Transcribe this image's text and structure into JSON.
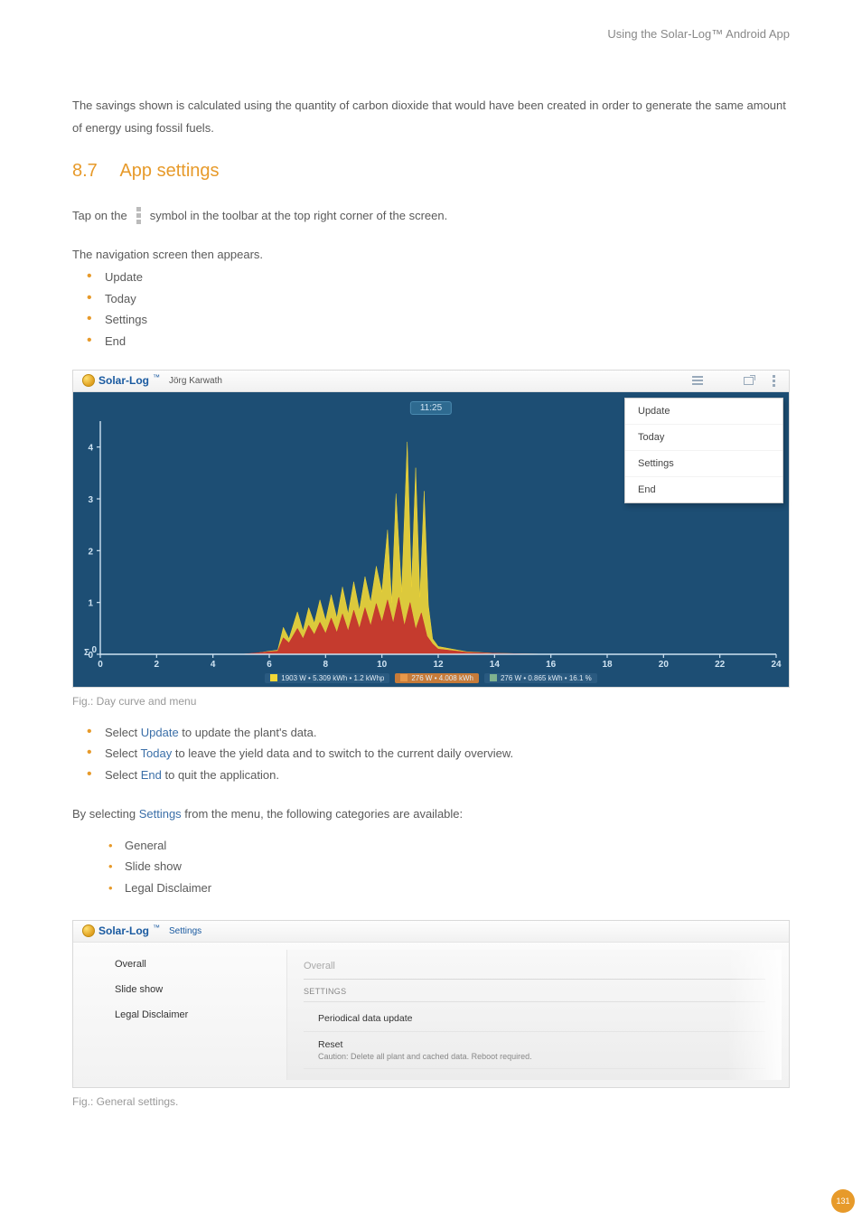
{
  "header": {
    "title": "Using the Solar-Log™ Android App"
  },
  "intro": "The savings shown is calculated using the quantity of carbon dioxide that would have been created in order to generate the same amount of energy using fossil fuels.",
  "section": {
    "num": "8.7",
    "title": "App settings"
  },
  "tap_line": {
    "pre": "Tap on the",
    "post": "symbol in the toolbar at the top right corner of the screen."
  },
  "nav_intro": "The navigation screen then appears.",
  "nav_items": {
    "a": "Update",
    "b": "Today",
    "c": "Settings",
    "d": "End"
  },
  "shot1": {
    "brand": "Solar-Log",
    "plant_name": "Jörg Karwath",
    "clock": "11:25",
    "menu": {
      "a": "Update",
      "b": "Today",
      "c": "Settings",
      "d": "End"
    },
    "legend": {
      "a": "1903 W • 5.309 kWh • 1.2 kWhp",
      "b": "276 W • 4.008 kWh",
      "c": "276 W • 0.865 kWh • 16.1 %"
    }
  },
  "fig1_cap": "Fig.: Day curve and menu",
  "instructions": {
    "a_pre": "Select ",
    "a_kw": "Update",
    "a_post": " to update the plant's data.",
    "b_pre": "Select ",
    "b_kw": "Today",
    "b_post": " to leave the yield data and to switch to the current daily overview.",
    "c_pre": "Select ",
    "c_kw": "End",
    "c_post": " to quit the application."
  },
  "settings_para_pre": "By selecting ",
  "settings_kw": "Settings",
  "settings_para_post": " from the menu, the following categories are available:",
  "settings_cats": {
    "a": "General",
    "b": "Slide show",
    "c": "Legal Disclaimer"
  },
  "shot2": {
    "brand": "Solar-Log",
    "crumb": "Settings",
    "side": {
      "a": "Overall",
      "b": "Slide show",
      "c": "Legal Disclaimer"
    },
    "main": {
      "heading": "Overall",
      "sub": "SETTINGS",
      "item1": "Periodical data update",
      "item2": "Reset",
      "item2_cap": "Caution: Delete all plant and cached data. Reboot required."
    }
  },
  "fig2_cap": "Fig.: General settings.",
  "page_num": "131",
  "chart_data": {
    "type": "area",
    "xlabel": "",
    "ylabel": "",
    "x_ticks": [
      0,
      2,
      4,
      6,
      8,
      10,
      12,
      14,
      16,
      18,
      20,
      22,
      24
    ],
    "y_ticks": [
      0,
      1,
      2,
      3,
      4
    ],
    "xlim": [
      0,
      24
    ],
    "ylim": [
      0,
      4.5
    ],
    "units": "kW",
    "series": [
      {
        "name": "yellow",
        "color": "#f2d736",
        "points": [
          [
            5.0,
            0.0
          ],
          [
            5.5,
            0.02
          ],
          [
            6.0,
            0.06
          ],
          [
            6.3,
            0.08
          ],
          [
            6.5,
            0.52
          ],
          [
            6.7,
            0.3
          ],
          [
            7.0,
            0.82
          ],
          [
            7.2,
            0.45
          ],
          [
            7.4,
            0.9
          ],
          [
            7.6,
            0.6
          ],
          [
            7.8,
            1.05
          ],
          [
            8.0,
            0.65
          ],
          [
            8.2,
            1.15
          ],
          [
            8.4,
            0.7
          ],
          [
            8.6,
            1.3
          ],
          [
            8.8,
            0.78
          ],
          [
            9.0,
            1.4
          ],
          [
            9.2,
            0.85
          ],
          [
            9.4,
            1.5
          ],
          [
            9.6,
            1.0
          ],
          [
            9.8,
            1.7
          ],
          [
            10.0,
            1.2
          ],
          [
            10.2,
            2.4
          ],
          [
            10.35,
            1.0
          ],
          [
            10.5,
            3.1
          ],
          [
            10.7,
            1.2
          ],
          [
            10.9,
            4.1
          ],
          [
            11.05,
            1.3
          ],
          [
            11.2,
            3.6
          ],
          [
            11.35,
            1.1
          ],
          [
            11.5,
            3.15
          ],
          [
            11.65,
            0.95
          ],
          [
            11.8,
            0.3
          ],
          [
            12.0,
            0.15
          ],
          [
            13.0,
            0.05
          ],
          [
            14.0,
            0.02
          ],
          [
            16.0,
            0.0
          ]
        ]
      },
      {
        "name": "red",
        "color": "#c22f2e",
        "points": [
          [
            5.0,
            0.0
          ],
          [
            6.0,
            0.05
          ],
          [
            6.3,
            0.06
          ],
          [
            6.5,
            0.32
          ],
          [
            6.7,
            0.22
          ],
          [
            7.0,
            0.5
          ],
          [
            7.2,
            0.3
          ],
          [
            7.4,
            0.56
          ],
          [
            7.6,
            0.38
          ],
          [
            7.8,
            0.62
          ],
          [
            8.0,
            0.4
          ],
          [
            8.2,
            0.7
          ],
          [
            8.4,
            0.42
          ],
          [
            8.6,
            0.78
          ],
          [
            8.8,
            0.45
          ],
          [
            9.0,
            0.85
          ],
          [
            9.2,
            0.5
          ],
          [
            9.4,
            0.9
          ],
          [
            9.6,
            0.55
          ],
          [
            9.8,
            0.98
          ],
          [
            10.0,
            0.62
          ],
          [
            10.2,
            1.05
          ],
          [
            10.4,
            0.6
          ],
          [
            10.6,
            1.1
          ],
          [
            10.8,
            0.55
          ],
          [
            11.0,
            1.0
          ],
          [
            11.2,
            0.48
          ],
          [
            11.4,
            0.8
          ],
          [
            11.6,
            0.35
          ],
          [
            11.8,
            0.2
          ],
          [
            12.0,
            0.1
          ],
          [
            13.0,
            0.04
          ],
          [
            14.0,
            0.02
          ],
          [
            16.0,
            0.0
          ]
        ]
      }
    ]
  }
}
